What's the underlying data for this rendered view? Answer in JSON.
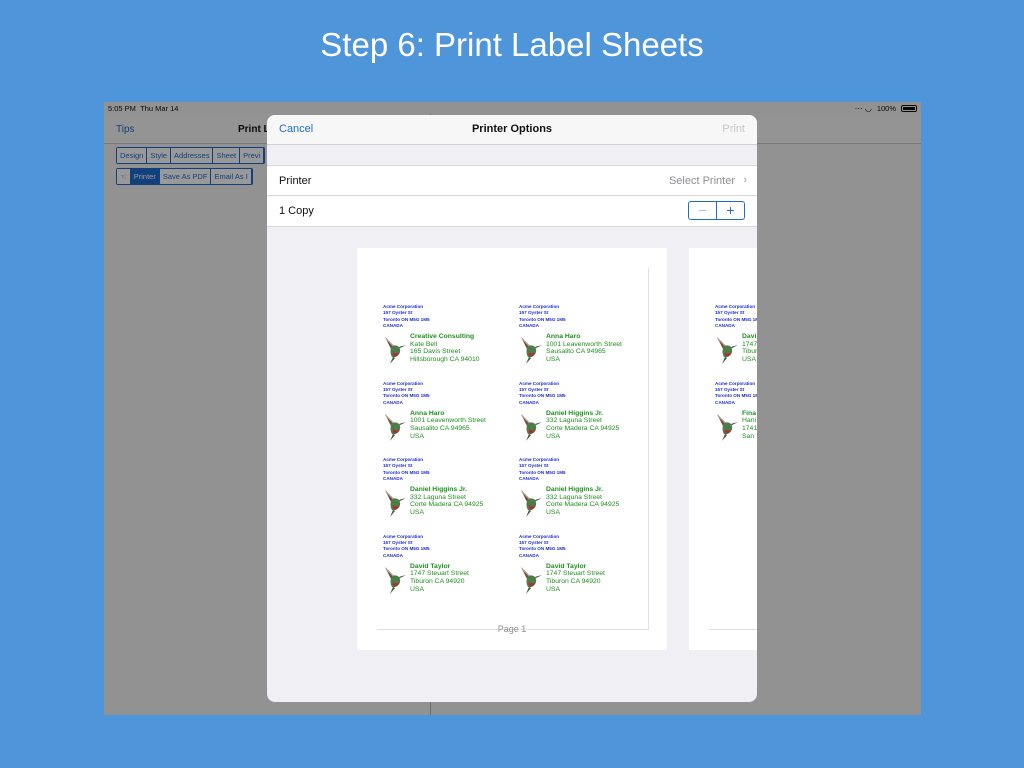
{
  "header": {
    "title": "Step 6: Print Label Sheets"
  },
  "status_bar": {
    "time": "5:05 PM",
    "date": "Thu Mar 14",
    "battery": "100%"
  },
  "background_app": {
    "tips": "Tips",
    "title": "Print L",
    "tabs": [
      "Design",
      "Style",
      "Addresses",
      "Sheet",
      "Previ"
    ],
    "actions": [
      "Printer",
      "Save As PDF",
      "Email As I"
    ]
  },
  "modal": {
    "cancel": "Cancel",
    "title": "Printer Options",
    "print": "Print",
    "printer_label": "Printer",
    "printer_value": "Select Printer",
    "copies_label": "1 Copy",
    "minus": "−",
    "plus": "+",
    "page_label": "Page 1"
  },
  "return_address": [
    "Acme Corporation",
    "157 Oyster St",
    "Toronto ON M5G 1M5",
    "CANADA"
  ],
  "labels": [
    [
      "Creative Consulting",
      "Kate Bell",
      "165 Davis Street",
      "Hillsborough CA 94010"
    ],
    [
      "Anna Haro",
      "1001  Leavenworth Street",
      "Sausalito CA 94965",
      "USA"
    ],
    [
      "Anna Haro",
      "1001  Leavenworth Street",
      "Sausalito CA 94965",
      "USA"
    ],
    [
      "Daniel Higgins Jr.",
      "332 Laguna Street",
      "Corte Madera CA 94925",
      "USA"
    ],
    [
      "Daniel Higgins Jr.",
      "332 Laguna Street",
      "Corte Madera CA 94925",
      "USA"
    ],
    [
      "Daniel Higgins Jr.",
      "332 Laguna Street",
      "Corte Madera CA 94925",
      "USA"
    ],
    [
      "David Taylor",
      "1747 Steuart Street",
      "Tiburon CA 94920",
      "USA"
    ],
    [
      "David Taylor",
      "1747 Steuart Street",
      "Tiburon CA 94920",
      "USA"
    ]
  ],
  "sheet2_labels": [
    [
      "Davi",
      "1747",
      "Tibur",
      "USA"
    ],
    [
      "Fina",
      "Hani",
      "1741",
      "San"
    ]
  ],
  "colors": {
    "background": "#4f95da",
    "accent": "#1f6ccf",
    "return_address": "#1c2bd6",
    "recipient": "#1f8f1f"
  }
}
